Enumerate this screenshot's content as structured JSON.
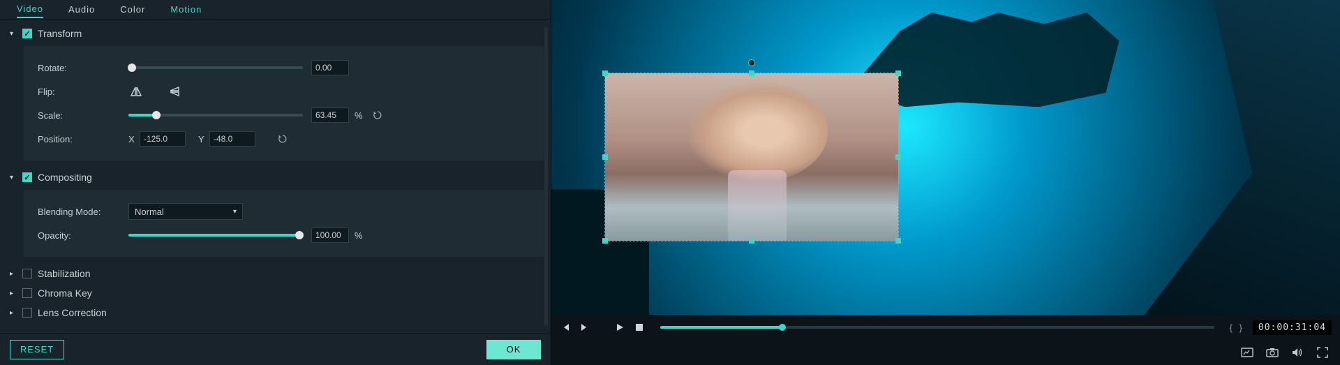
{
  "tabs": {
    "video": "Video",
    "audio": "Audio",
    "color": "Color",
    "motion": "Motion"
  },
  "transform": {
    "title": "Transform",
    "rotate_label": "Rotate:",
    "rotate_value": "0.00",
    "flip_label": "Flip:",
    "scale_label": "Scale:",
    "scale_value": "63.45",
    "scale_unit": "%",
    "position_label": "Position:",
    "pos_x_label": "X",
    "pos_x_value": "-125.0",
    "pos_y_label": "Y",
    "pos_y_value": "-48.0"
  },
  "compositing": {
    "title": "Compositing",
    "blend_label": "Blending Mode:",
    "blend_value": "Normal",
    "opacity_label": "Opacity:",
    "opacity_value": "100.00",
    "opacity_unit": "%"
  },
  "sections": {
    "stabilization": "Stabilization",
    "chroma_key": "Chroma Key",
    "lens_correction": "Lens Correction"
  },
  "buttons": {
    "reset": "RESET",
    "ok": "OK"
  },
  "player": {
    "timecode": "00:00:31:04",
    "markers": "{   }"
  }
}
